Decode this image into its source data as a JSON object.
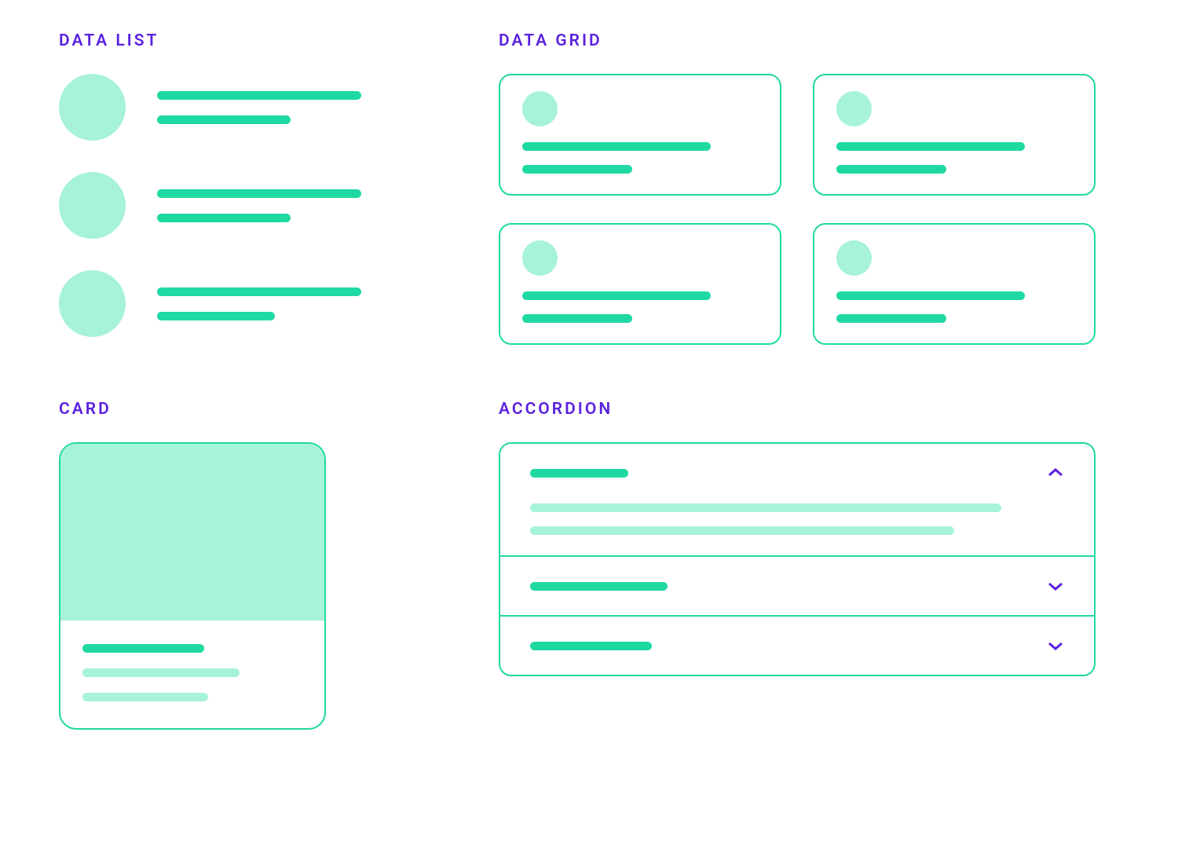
{
  "colors": {
    "accent_purple": "#5B21E0",
    "teal_solid": "#1FD9A3",
    "teal_light": "#A7F3D7"
  },
  "sections": {
    "data_list": {
      "title": "DATA LIST"
    },
    "data_grid": {
      "title": "DATA GRID"
    },
    "card": {
      "title": "CARD"
    },
    "accordion": {
      "title": "ACCORDION"
    }
  },
  "data_list": {
    "items": [
      {
        "avatar": "circle-icon",
        "line1_width": "long",
        "line2_width": "medium"
      },
      {
        "avatar": "circle-icon",
        "line1_width": "long",
        "line2_width": "medium"
      },
      {
        "avatar": "circle-icon",
        "line1_width": "long",
        "line2_width": "short"
      }
    ]
  },
  "data_grid": {
    "cards": [
      {
        "avatar": "circle-icon",
        "line1_width": "long",
        "line2_width": "short"
      },
      {
        "avatar": "circle-icon",
        "line1_width": "long",
        "line2_width": "short"
      },
      {
        "avatar": "circle-icon",
        "line1_width": "long",
        "line2_width": "short"
      },
      {
        "avatar": "circle-icon",
        "line1_width": "long",
        "line2_width": "short"
      }
    ]
  },
  "card": {
    "image": "placeholder",
    "title_width": "short",
    "body_lines": [
      "medium",
      "short"
    ]
  },
  "accordion": {
    "items": [
      {
        "expanded": true,
        "header_width": "short",
        "body_lines": [
          "long",
          "medium"
        ],
        "icon": "chevron-up-icon"
      },
      {
        "expanded": false,
        "header_width": "medium",
        "icon": "chevron-down-icon"
      },
      {
        "expanded": false,
        "header_width": "short",
        "icon": "chevron-down-icon"
      }
    ]
  }
}
